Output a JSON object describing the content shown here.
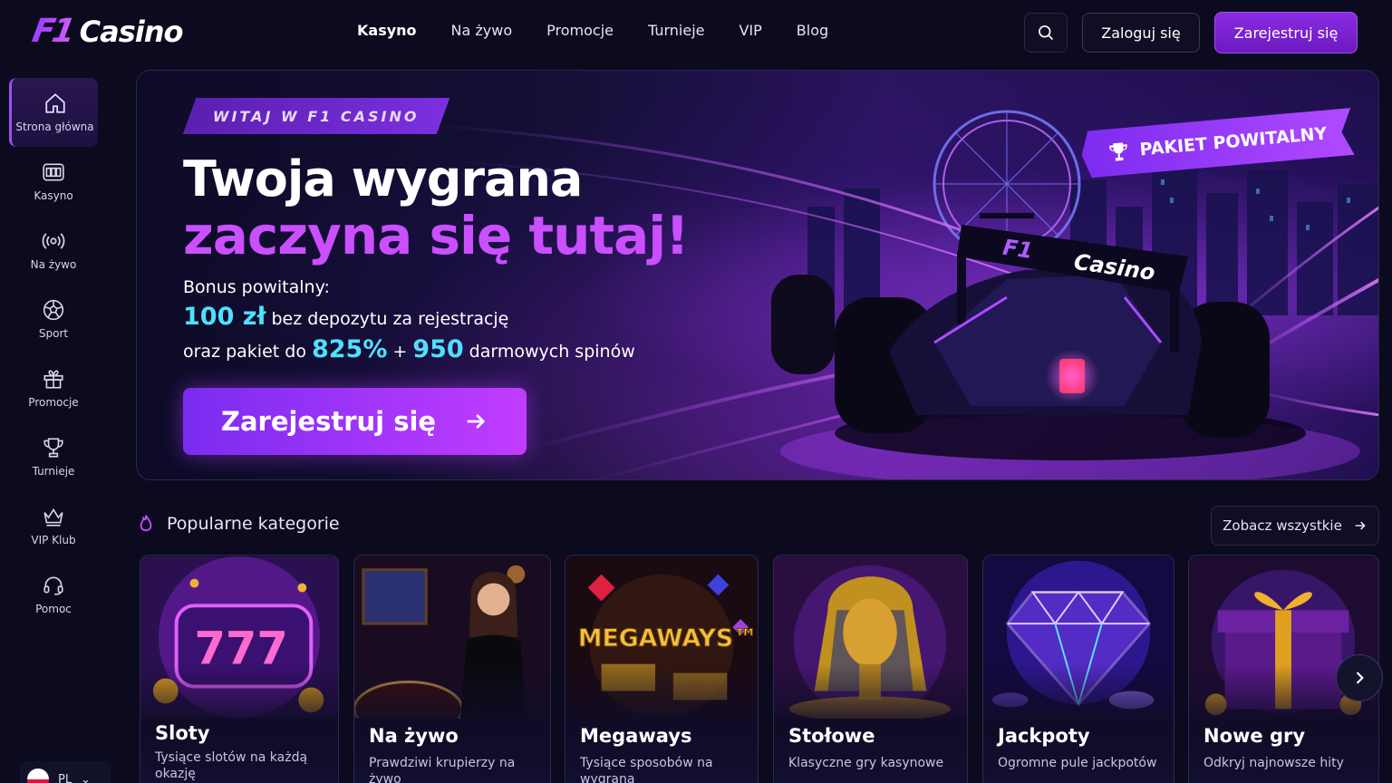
{
  "header": {
    "logo_f1": "F1",
    "logo_casino": "Casino",
    "nav": [
      "Kasyno",
      "Na żywo",
      "Promocje",
      "Turnieje",
      "VIP",
      "Blog"
    ],
    "login_label": "Zaloguj się",
    "register_label": "Zarejestruj się"
  },
  "sidebar": {
    "items": [
      {
        "label": "Strona główna",
        "icon": "home-icon"
      },
      {
        "label": "Kasyno",
        "icon": "slot-machine-icon"
      },
      {
        "label": "Na żywo",
        "icon": "broadcast-icon"
      },
      {
        "label": "Sport",
        "icon": "football-icon"
      },
      {
        "label": "Promocje",
        "icon": "gift-icon"
      },
      {
        "label": "Turnieje",
        "icon": "trophy-icon"
      },
      {
        "label": "VIP Klub",
        "icon": "crown-icon"
      },
      {
        "label": "Pomoc",
        "icon": "headset-icon"
      }
    ],
    "language": "PL"
  },
  "hero": {
    "tag": "WITAJ W F1 CASINO",
    "title_line1": "Twoja wygrana",
    "title_line2": "zaczyna się tutaj!",
    "bonus_label": "Bonus powitalny:",
    "amount": "100 zł",
    "amount_text": "bez depozytu za rejestrację",
    "package_prefix": "oraz pakiet do",
    "percent": "825%",
    "plus": "+",
    "spins": "950",
    "spins_text": "darmowych spinów",
    "cta": "Zarejestruj się",
    "ribbon": "PAKIET POWITALNY",
    "car_logo_f1": "F1",
    "car_logo_casino": "Casino"
  },
  "categories": {
    "title": "Popularne kategorie",
    "see_all": "Zobacz wszystkie",
    "items": [
      {
        "title": "Sloty",
        "desc": "Tysiące slotów na każdą okazję"
      },
      {
        "title": "Na żywo",
        "desc": "Prawdziwi krupierzy na żywo"
      },
      {
        "title": "Megaways",
        "desc": "Tysiące sposobów na wygrana",
        "art_text": "MEGAWAYS™"
      },
      {
        "title": "Stołowe",
        "desc": "Klasyczne gry kasynowe"
      },
      {
        "title": "Jackpoty",
        "desc": "Ogromne pule jackpotów"
      },
      {
        "title": "Nowe gry",
        "desc": "Odkryj najnowsze hity"
      }
    ]
  },
  "colors": {
    "accent": "#8a2be2",
    "accent_light": "#c94fff",
    "cyan": "#4fe0ff",
    "background": "#0b0a1e"
  }
}
